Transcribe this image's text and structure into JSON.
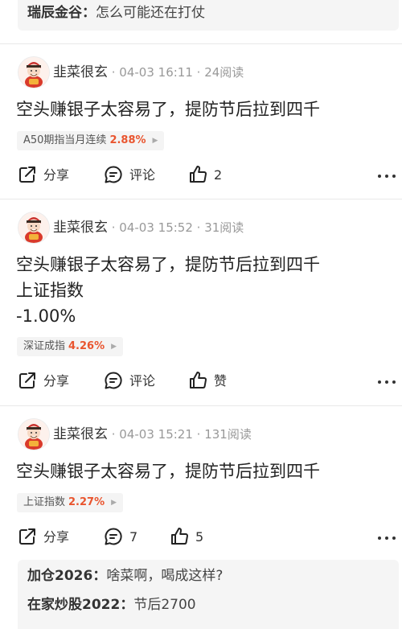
{
  "top_comment": {
    "user": "瑞辰金谷",
    "text": "怎么可能还在打仗"
  },
  "posts": [
    {
      "author": "韭菜很玄",
      "meta": " · 04-03 16:11 · 24阅读",
      "title_lines": [
        "空头赚银子太容易了，提防节后拉到四千"
      ],
      "tag": {
        "name": "A50期指当月连续",
        "value": "2.88%"
      },
      "actions": {
        "share": "分享",
        "comment": "评论",
        "like": "2"
      }
    },
    {
      "author": "韭菜很玄",
      "meta": " · 04-03 15:52 · 31阅读",
      "title_lines": [
        "空头赚银子太容易了，提防节后拉到四千",
        "上证指数",
        "-1.00%"
      ],
      "tag": {
        "name": "深证成指",
        "value": "4.26%"
      },
      "actions": {
        "share": "分享",
        "comment": "评论",
        "like": "赞"
      }
    },
    {
      "author": "韭菜很玄",
      "meta": " · 04-03 15:21 · 131阅读",
      "title_lines": [
        "空头赚银子太容易了，提防节后拉到四千"
      ],
      "tag": {
        "name": "上证指数",
        "value": "2.27%"
      },
      "actions": {
        "share": "分享",
        "comment": "7",
        "like": "5"
      }
    }
  ],
  "replies": [
    {
      "user": "加仓2026",
      "text": "啥菜啊，喝成这样?"
    },
    {
      "user": "在家炒股2022",
      "text": "节后2700"
    }
  ],
  "colors": {
    "accent": "#e9552f",
    "divider": "#e8e8e8",
    "box": "#f5f5f5"
  },
  "icons": {
    "share": "share-icon",
    "comment": "comment-icon",
    "like": "thumbs-up-icon",
    "more": "more-icon",
    "tag_arrow": "triangle-right-icon"
  }
}
